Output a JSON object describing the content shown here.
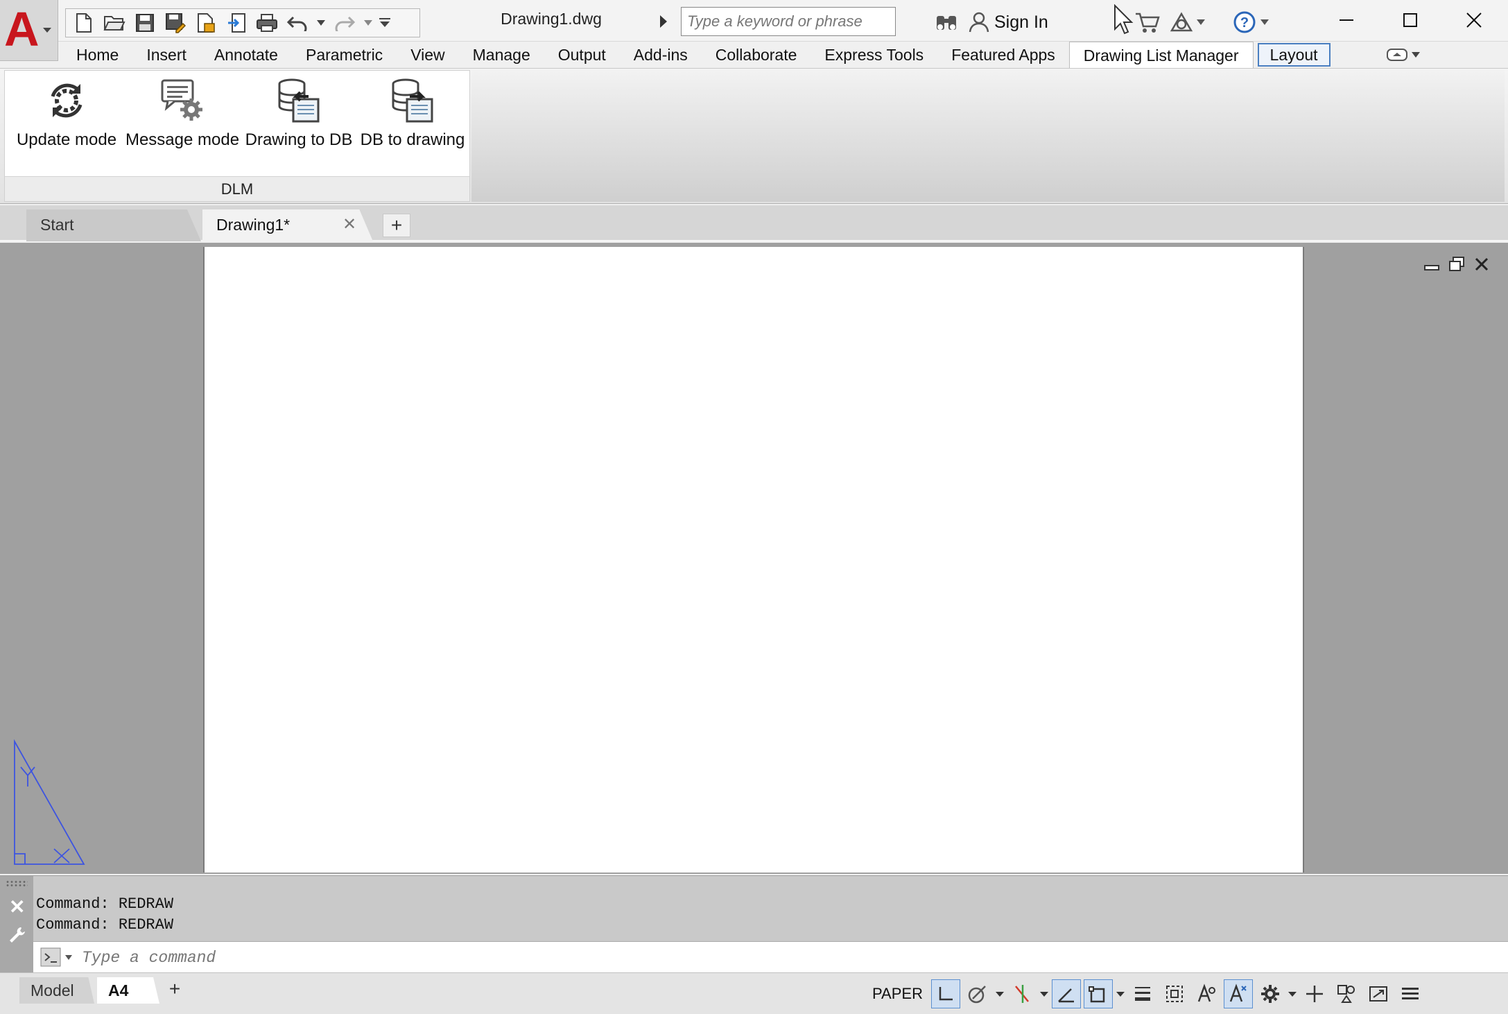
{
  "app": {
    "document_title": "Drawing1.dwg",
    "search_placeholder": "Type a keyword or phrase",
    "sign_in_label": "Sign In",
    "brand_color": "#c8161d"
  },
  "window_controls": [
    "minimize-icon",
    "maximize-icon",
    "close-icon"
  ],
  "ribbon": {
    "tabs": [
      {
        "label": "Home"
      },
      {
        "label": "Insert"
      },
      {
        "label": "Annotate"
      },
      {
        "label": "Parametric"
      },
      {
        "label": "View"
      },
      {
        "label": "Manage"
      },
      {
        "label": "Output"
      },
      {
        "label": "Add-ins"
      },
      {
        "label": "Collaborate"
      },
      {
        "label": "Express Tools"
      },
      {
        "label": "Featured Apps"
      },
      {
        "label": "Drawing List Manager",
        "active": true
      },
      {
        "label": "Layout",
        "framed": true
      }
    ],
    "panel": {
      "title": "DLM",
      "buttons": [
        {
          "label": "Update mode",
          "icon": "update-mode-icon"
        },
        {
          "label": "Message mode",
          "icon": "message-mode-icon"
        },
        {
          "label": "Drawing to DB",
          "icon": "drawing-to-db-icon"
        },
        {
          "label": "DB to drawing",
          "icon": "db-to-drawing-icon"
        }
      ]
    }
  },
  "file_tabs": {
    "start": "Start",
    "active": "Drawing1*"
  },
  "command_line": {
    "history": [
      "Command:  REDRAW",
      "Command:  REDRAW"
    ],
    "placeholder": "Type a command"
  },
  "layout_tabs": {
    "model": "Model",
    "active": "A4"
  },
  "status_bar": {
    "space_label": "PAPER",
    "accent_color": "#5b8fd0"
  }
}
